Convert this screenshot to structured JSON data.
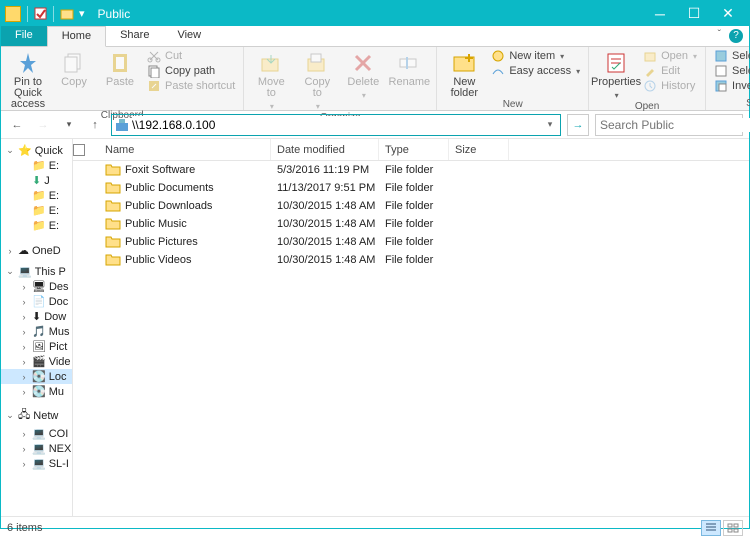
{
  "window": {
    "title": "Public"
  },
  "tabs": {
    "file": "File",
    "home": "Home",
    "share": "Share",
    "view": "View"
  },
  "ribbon": {
    "clipboard": {
      "label": "Clipboard",
      "pin": "Pin to Quick\naccess",
      "copy": "Copy",
      "paste": "Paste",
      "cut": "Cut",
      "copypath": "Copy path",
      "pasteshort": "Paste shortcut"
    },
    "organize": {
      "label": "Organize",
      "moveto": "Move\nto",
      "copyto": "Copy\nto",
      "delete": "Delete",
      "rename": "Rename"
    },
    "new": {
      "label": "New",
      "newfolder": "New\nfolder",
      "newitem": "New item",
      "easyaccess": "Easy access"
    },
    "open": {
      "label": "Open",
      "properties": "Properties",
      "open": "Open",
      "edit": "Edit",
      "history": "History"
    },
    "select": {
      "label": "Select",
      "selectall": "Select all",
      "selectnone": "Select none",
      "invert": "Invert selection"
    }
  },
  "address": {
    "value": "\\\\192.168.0.100"
  },
  "search": {
    "placeholder": "Search Public"
  },
  "columns": {
    "name": "Name",
    "date": "Date modified",
    "type": "Type",
    "size": "Size"
  },
  "items": [
    {
      "name": "Foxit Software",
      "date": "5/3/2016 11:19 PM",
      "type": "File folder"
    },
    {
      "name": "Public Documents",
      "date": "11/13/2017 9:51 PM",
      "type": "File folder"
    },
    {
      "name": "Public Downloads",
      "date": "10/30/2015 1:48 AM",
      "type": "File folder"
    },
    {
      "name": "Public Music",
      "date": "10/30/2015 1:48 AM",
      "type": "File folder"
    },
    {
      "name": "Public Pictures",
      "date": "10/30/2015 1:48 AM",
      "type": "File folder"
    },
    {
      "name": "Public Videos",
      "date": "10/30/2015 1:48 AM",
      "type": "File folder"
    }
  ],
  "tree": {
    "quick": "Quick",
    "e1": "E:",
    "j": "J",
    "e2": "E:",
    "e3": "E:",
    "e4": "E:",
    "onedrive": "OneD",
    "thispc": "This P",
    "des": "Des",
    "doc": "Doc",
    "dow": "Dow",
    "mus": "Mus",
    "pict": "Pict",
    "vid": "Vide",
    "loc": "Loc",
    "mu2": "Mu",
    "netw": "Netw",
    "coi": "COI",
    "nex": "NEX",
    "sli": "SL-I"
  },
  "status": {
    "count": "6 items"
  }
}
